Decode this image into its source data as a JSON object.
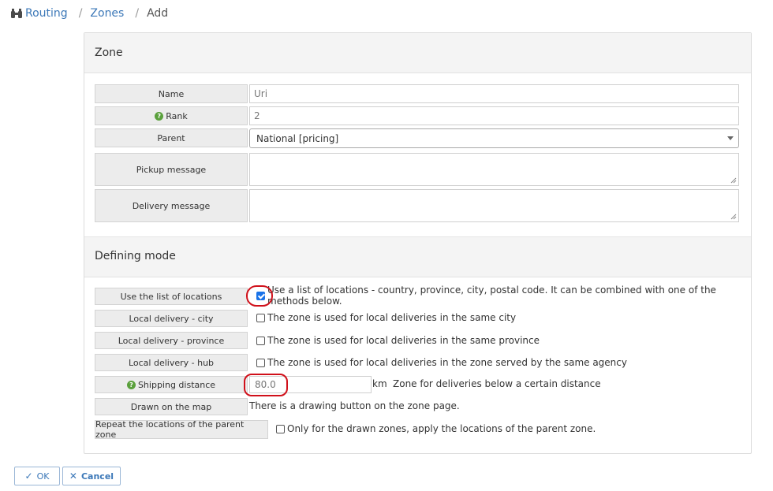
{
  "breadcrumb": {
    "items": [
      "Routing",
      "Zones"
    ],
    "current": "Add",
    "icon": "binoculars-icon"
  },
  "sections": {
    "zone_title": "Zone",
    "defining_title": "Defining mode"
  },
  "zone_form": {
    "name_label": "Name",
    "name_value": "Uri",
    "rank_label": "Rank",
    "rank_value": "2",
    "parent_label": "Parent",
    "parent_value": "National [pricing]",
    "pickup_label": "Pickup message",
    "delivery_label": "Delivery message"
  },
  "defining_mode": {
    "list_locations_label": "Use the list of locations",
    "list_locations_text": "Use a list of locations - country, province, city, postal code. It can be combined with one of the methods below.",
    "list_locations_checked": true,
    "local_city_label": "Local delivery - city",
    "local_city_text": "The zone is used for local deliveries in the same city",
    "local_province_label": "Local delivery - province",
    "local_province_text": "The zone is used for local deliveries in the same province",
    "local_hub_label": "Local delivery - hub",
    "local_hub_text": "The zone is used for local deliveries in the zone served by the same agency",
    "shipping_distance_label": "Shipping distance",
    "shipping_distance_value": "80.0",
    "shipping_distance_unit": "km",
    "shipping_distance_text": "Zone for deliveries below a certain distance",
    "drawn_map_label": "Drawn on the map",
    "drawn_map_text": "There is a drawing button on the zone page.",
    "repeat_parent_label": "Repeat the locations of the parent zone",
    "repeat_parent_text": "Only for the drawn zones, apply the locations of the parent zone."
  },
  "actions": {
    "ok_label": "OK",
    "cancel_label": "Cancel"
  },
  "colors": {
    "link": "#3c78b8",
    "annotation": "#d0101a",
    "help": "#5aa03c"
  }
}
